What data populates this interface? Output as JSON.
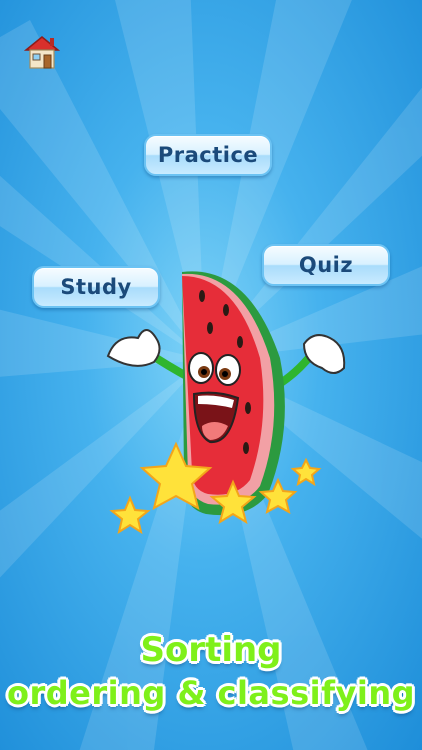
{
  "header": {
    "home_icon": "home-icon"
  },
  "menu": {
    "practice": "Practice",
    "quiz": "Quiz",
    "study": "Study"
  },
  "mascot": {
    "icon": "watermelon-mascot",
    "stars": 5
  },
  "title": {
    "line1": "Sorting",
    "line2": "ordering & classifying"
  },
  "colors": {
    "background": "#46b2ee",
    "button_text": "#1b4a7a",
    "title": "#7ff01a"
  }
}
